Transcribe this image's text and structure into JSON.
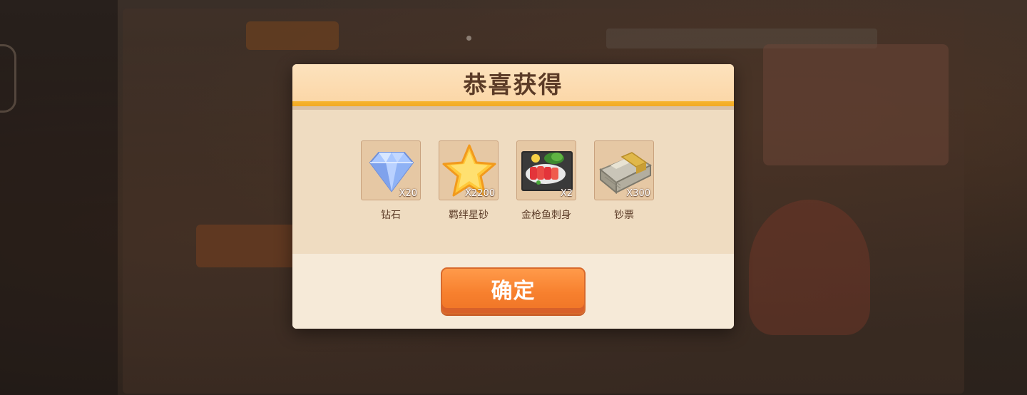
{
  "dialog": {
    "title": "恭喜获得",
    "confirm_label": "确定",
    "rewards": [
      {
        "icon": "diamond-icon",
        "quantity": "X20",
        "name": "钻石"
      },
      {
        "icon": "star-icon",
        "quantity": "X2200",
        "name": "羁绊星砂"
      },
      {
        "icon": "tuna-sashimi-icon",
        "quantity": "X2",
        "name": "金枪鱼刺身"
      },
      {
        "icon": "banknotes-icon",
        "quantity": "X300",
        "name": "钞票"
      }
    ]
  },
  "colors": {
    "title_text": "#5b3b27",
    "header_stripe": "#f6b42f",
    "button": "#f7802e",
    "slot": "#e6c8a4"
  }
}
